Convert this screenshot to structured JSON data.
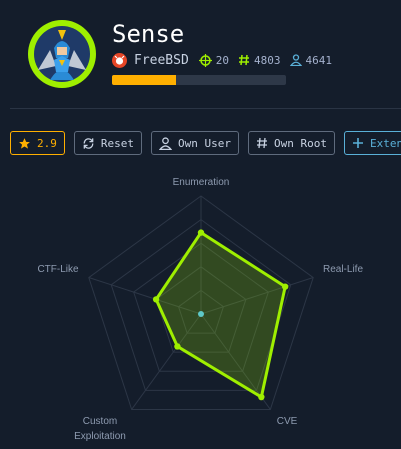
{
  "machine": {
    "name": "Sense",
    "os": "FreeBSD",
    "points": "20",
    "root_owns": "4803",
    "user_owns": "4641",
    "progress_fraction": 0.37
  },
  "toolbar": {
    "rating": "2.9",
    "reset": "Reset",
    "own_user": "Own User",
    "own_root": "Own Root",
    "extend": "Extend"
  },
  "colors": {
    "background": "#141d2b",
    "accent_green": "#9fef00",
    "rating_orange": "#ffaf00",
    "os_icon": "#e64627",
    "extend_blue": "#5ab0d8"
  },
  "chart_data": {
    "type": "radar",
    "axes": [
      "Enumeration",
      "Real-Life",
      "CVE",
      "Custom Exploitation",
      "CTF-Like"
    ],
    "axis_label_lines": [
      [
        "Enumeration"
      ],
      [
        "Real-Life"
      ],
      [
        "CVE"
      ],
      [
        "Custom",
        "Exploitation"
      ],
      [
        "CTF-Like"
      ]
    ],
    "range": [
      0,
      10
    ],
    "rings": 5,
    "values": [
      6.9,
      7.5,
      8.7,
      3.4,
      4.0
    ],
    "series_color": "#9fef00"
  }
}
